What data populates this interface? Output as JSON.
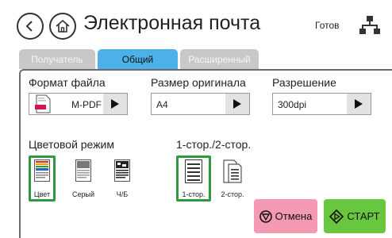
{
  "header": {
    "title": "Электронная почта",
    "status": "Готов",
    "back_icon": "chevron-left-icon",
    "home_icon": "home-icon",
    "network_icon": "network-icon"
  },
  "tabs": [
    {
      "label": "Получатель",
      "active": false
    },
    {
      "label": "Общий",
      "active": true
    },
    {
      "label": "Расширенный",
      "active": false
    }
  ],
  "settings": {
    "file_format": {
      "label": "Формат файла",
      "value": "M-PDF",
      "icon": "pdf-file-icon"
    },
    "original_size": {
      "label": "Размер оригинала",
      "value": "A4"
    },
    "resolution": {
      "label": "Разрешение",
      "value": "300dpi"
    }
  },
  "color_mode": {
    "label": "Цветовой режим",
    "options": [
      {
        "label": "Цвет",
        "selected": true
      },
      {
        "label": "Серый",
        "selected": false
      },
      {
        "label": "Ч/Б",
        "selected": false
      }
    ]
  },
  "duplex": {
    "label": "1-стор./2-стор.",
    "options": [
      {
        "label": "1-стор.",
        "selected": true
      },
      {
        "label": "2-стор.",
        "selected": false
      }
    ]
  },
  "actions": {
    "cancel_label": "Отмена",
    "start_label": "СТАРТ"
  },
  "colors": {
    "tab_active": "#4db0e8",
    "tab_inactive": "#c8c8c8",
    "selected_border": "#2e9a3d",
    "cancel_bg": "#f49ab3",
    "start_bg": "#69c63f"
  }
}
